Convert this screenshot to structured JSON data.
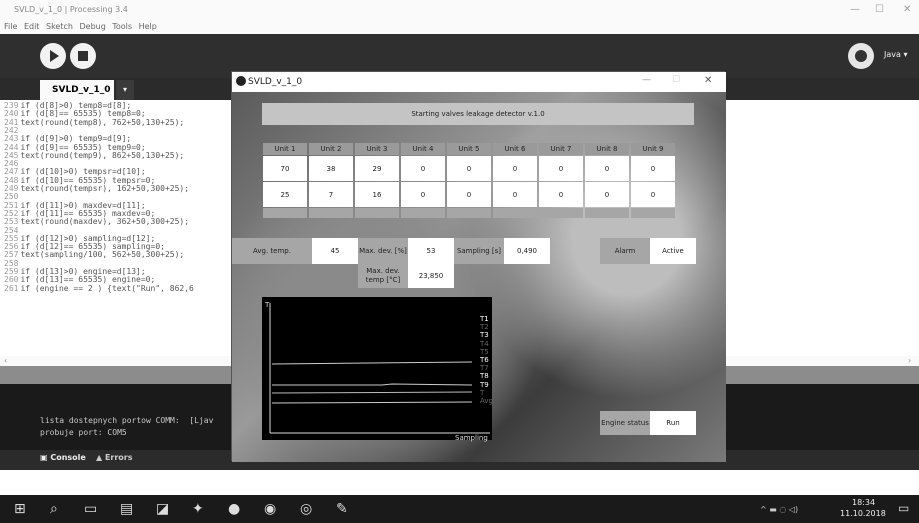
{
  "ide": {
    "title": "SVLD_v_1_0 | Processing 3.4",
    "menu": [
      "File",
      "Edit",
      "Sketch",
      "Debug",
      "Tools",
      "Help"
    ],
    "tab_label": "SVLD_v_1_0",
    "mode_label": "Java ▾",
    "code": [
      {
        "n": "239",
        "t": "if (d[8]>0) temp8=d[8];"
      },
      {
        "n": "240",
        "t": "if (d[8]== 65535) temp8=0;"
      },
      {
        "n": "241",
        "t": "text(round(temp8), 762+50,130+25);"
      },
      {
        "n": "242",
        "t": ""
      },
      {
        "n": "243",
        "t": "if (d[9]>0) temp9=d[9];"
      },
      {
        "n": "244",
        "t": "if (d[9]== 65535) temp9=0;"
      },
      {
        "n": "245",
        "t": "text(round(temp9), 862+50,130+25);"
      },
      {
        "n": "246",
        "t": ""
      },
      {
        "n": "247",
        "t": "if (d[10]>0) tempsr=d[10];"
      },
      {
        "n": "248",
        "t": "if (d[10]== 65535) tempsr=0;"
      },
      {
        "n": "249",
        "t": "text(round(tempsr), 162+50,300+25);"
      },
      {
        "n": "250",
        "t": ""
      },
      {
        "n": "251",
        "t": "if (d[11]>0) maxdev=d[11];"
      },
      {
        "n": "252",
        "t": "if (d[11]== 65535) maxdev=0;"
      },
      {
        "n": "253",
        "t": "text(round(maxdev), 362+50,300+25);"
      },
      {
        "n": "254",
        "t": ""
      },
      {
        "n": "255",
        "t": "if (d[12]>0) sampling=d[12];"
      },
      {
        "n": "256",
        "t": "if (d[12]== 65535) sampling=0;"
      },
      {
        "n": "257",
        "t": "text(sampling/100, 562+50,300+25);"
      },
      {
        "n": "258",
        "t": ""
      },
      {
        "n": "259",
        "t": "if (d[13]>0) engine=d[13];"
      },
      {
        "n": "260",
        "t": "if (d[13]== 65535) engine=0;"
      },
      {
        "n": "261",
        "t": "if (engine == 2 ) {text(\"Run\", 862,6"
      }
    ],
    "console": [
      "lista dostepnych portow COMM:  [Ljav",
      "probuje port: COM5"
    ],
    "console_tab": "Console",
    "errors_tab": "Errors"
  },
  "sketch": {
    "title": "SVLD_v_1_0",
    "banner": "Starting valves leakage detector v.1.0",
    "units": [
      "Unit 1",
      "Unit 2",
      "Unit 3",
      "Unit 4",
      "Unit 5",
      "Unit 6",
      "Unit 7",
      "Unit 8",
      "Unit 9"
    ],
    "row1": [
      "70",
      "38",
      "29",
      "0",
      "0",
      "0",
      "0",
      "0",
      "0"
    ],
    "row2": [
      "25",
      "7",
      "16",
      "0",
      "0",
      "0",
      "0",
      "0",
      "0"
    ],
    "avg_temp_label": "Avg. temp.",
    "avg_temp_value": "45",
    "max_dev_pct_label": "Max. dev. [%]",
    "max_dev_pct_value": "53",
    "sampling_label": "Sampling [s]",
    "sampling_value": "0,490",
    "alarm_label": "Alarm",
    "alarm_value": "Active",
    "max_dev_temp_label": "Max. dev. temp [°C]",
    "max_dev_temp_value": "23,850",
    "engine_status_label": "Engine status",
    "engine_status_value": "Run",
    "plot_y_label": "T",
    "plot_x_label": "Sampling",
    "legend": [
      "T1",
      "T2",
      "T3",
      "T4",
      "T5",
      "T6",
      "T7",
      "T8",
      "T9",
      "T Avg."
    ]
  },
  "taskbar": {
    "time": "18:34",
    "date": "11.10.2018"
  }
}
